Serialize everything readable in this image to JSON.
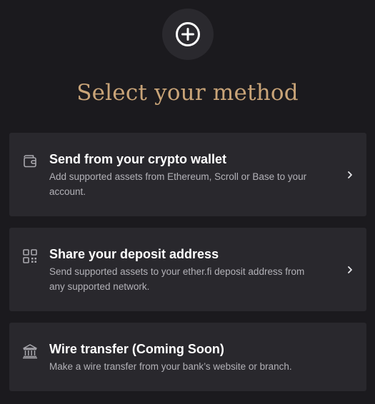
{
  "header": {
    "icon": "plus-circle-icon",
    "title": "Select your method"
  },
  "methods": [
    {
      "icon": "wallet-icon",
      "title": "Send from your crypto wallet",
      "description": "Add supported assets from Ethereum, Scroll or Base to your account.",
      "has_chevron": true
    },
    {
      "icon": "qr-code-icon",
      "title": "Share your deposit address",
      "description": "Send supported assets to your ether.fi deposit address from any supported network.",
      "has_chevron": true
    },
    {
      "icon": "bank-icon",
      "title": "Wire transfer (Coming Soon)",
      "description": "Make a wire transfer from your bank’s website or branch.",
      "has_chevron": false
    }
  ],
  "colors": {
    "background": "#1b1a1e",
    "card": "#29282d",
    "accent_title": "#c9a478",
    "text_primary": "#ffffff",
    "text_secondary": "#b3b2b8"
  }
}
